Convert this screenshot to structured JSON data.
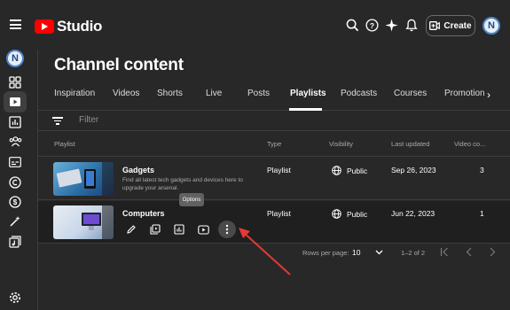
{
  "header": {
    "app_name": "Studio",
    "create_label": "Create",
    "avatar_letter": "N"
  },
  "page": {
    "title": "Channel content"
  },
  "tabs": [
    {
      "label": "Inspiration"
    },
    {
      "label": "Videos"
    },
    {
      "label": "Shorts"
    },
    {
      "label": "Live"
    },
    {
      "label": "Posts"
    },
    {
      "label": "Playlists",
      "active": true
    },
    {
      "label": "Podcasts"
    },
    {
      "label": "Courses"
    },
    {
      "label": "Promotion"
    }
  ],
  "filter": {
    "placeholder": "Filter"
  },
  "table": {
    "columns": [
      "Playlist",
      "Type",
      "Visibility",
      "Last updated",
      "Video co..."
    ],
    "rows": [
      {
        "title": "Gadgets",
        "description": "Find all latest tech gadgets and devices here to upgrade your arsenal.",
        "type": "Playlist",
        "visibility": "Public",
        "last_updated": "Sep 26, 2023",
        "video_count": "3"
      },
      {
        "title": "Computers",
        "description": "",
        "type": "Playlist",
        "visibility": "Public",
        "last_updated": "Jun 22, 2023",
        "video_count": "1"
      }
    ]
  },
  "tooltip": {
    "text": "Options"
  },
  "pagination": {
    "rows_per_page_label": "Rows per page:",
    "rows_per_page_value": "10",
    "range": "1–2 of 2"
  },
  "colors": {
    "brand_red": "#ff0000",
    "background": "#282828",
    "arrow": "#e53935"
  },
  "icons": [
    "menu-icon",
    "search-icon",
    "help-icon",
    "sparkle-icon",
    "bell-icon",
    "create-video-icon",
    "dashboard-icon",
    "content-icon",
    "analytics-icon",
    "community-icon",
    "subtitles-icon",
    "copyright-icon",
    "earn-icon",
    "customization-icon",
    "audio-library-icon",
    "settings-icon",
    "filter-icon",
    "globe-icon",
    "edit-icon",
    "add-to-playlist-icon",
    "playlist-analytics-icon",
    "youtube-icon",
    "more-vert-icon",
    "chevron-down-icon",
    "first-page-icon",
    "prev-page-icon",
    "next-page-icon",
    "last-page-icon"
  ]
}
